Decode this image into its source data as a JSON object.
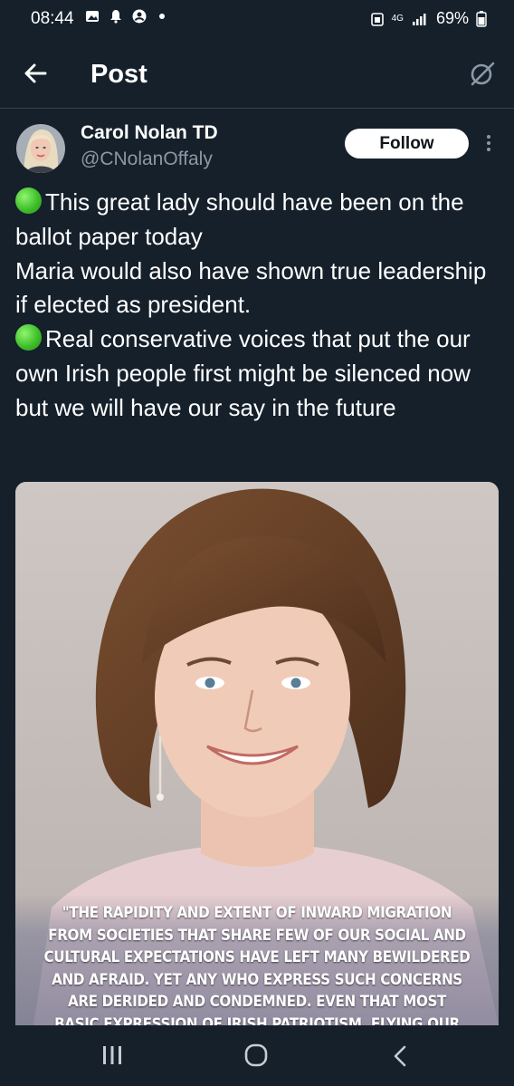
{
  "status_bar": {
    "time": "08:44",
    "network": "4G",
    "battery": "69%"
  },
  "header": {
    "title": "Post"
  },
  "tweet": {
    "author_name": "Carol Nolan TD",
    "author_handle": "@CNolanOffaly",
    "follow_label": "Follow",
    "paragraph_1": "This great lady should have been on the ballot paper today\nMaria would also have shown true leadership if elected as president.",
    "paragraph_2": "Real conservative voices that put the our own Irish people first might be silenced now but we will have our say in the future",
    "emoji": "green-circle"
  },
  "media": {
    "quote_lines": [
      "\"THE RAPIDITY AND EXTENT OF INWARD MIGRATION",
      "FROM SOCIETIES THAT SHARE FEW OF OUR SOCIAL AND",
      "CULTURAL EXPECTATIONS HAVE LEFT MANY BEWILDERED",
      "AND AFRAID. YET ANY WHO EXPRESS SUCH CONCERNS",
      "ARE DERIDED AND CONDEMNED. EVEN THAT MOST",
      "BASIC EXPRESSION OF IRISH PATRIOTISM, FLYING OUR"
    ]
  },
  "icons": {
    "back": "arrow-left-icon",
    "grok": "grok-icon",
    "more": "more-vertical-icon",
    "nav_recent": "recent-apps-icon",
    "nav_home": "home-circle-icon",
    "nav_back": "nav-back-icon"
  },
  "colors": {
    "background": "#15202b",
    "secondary_text": "#8b98a5",
    "divider": "#38444d"
  }
}
